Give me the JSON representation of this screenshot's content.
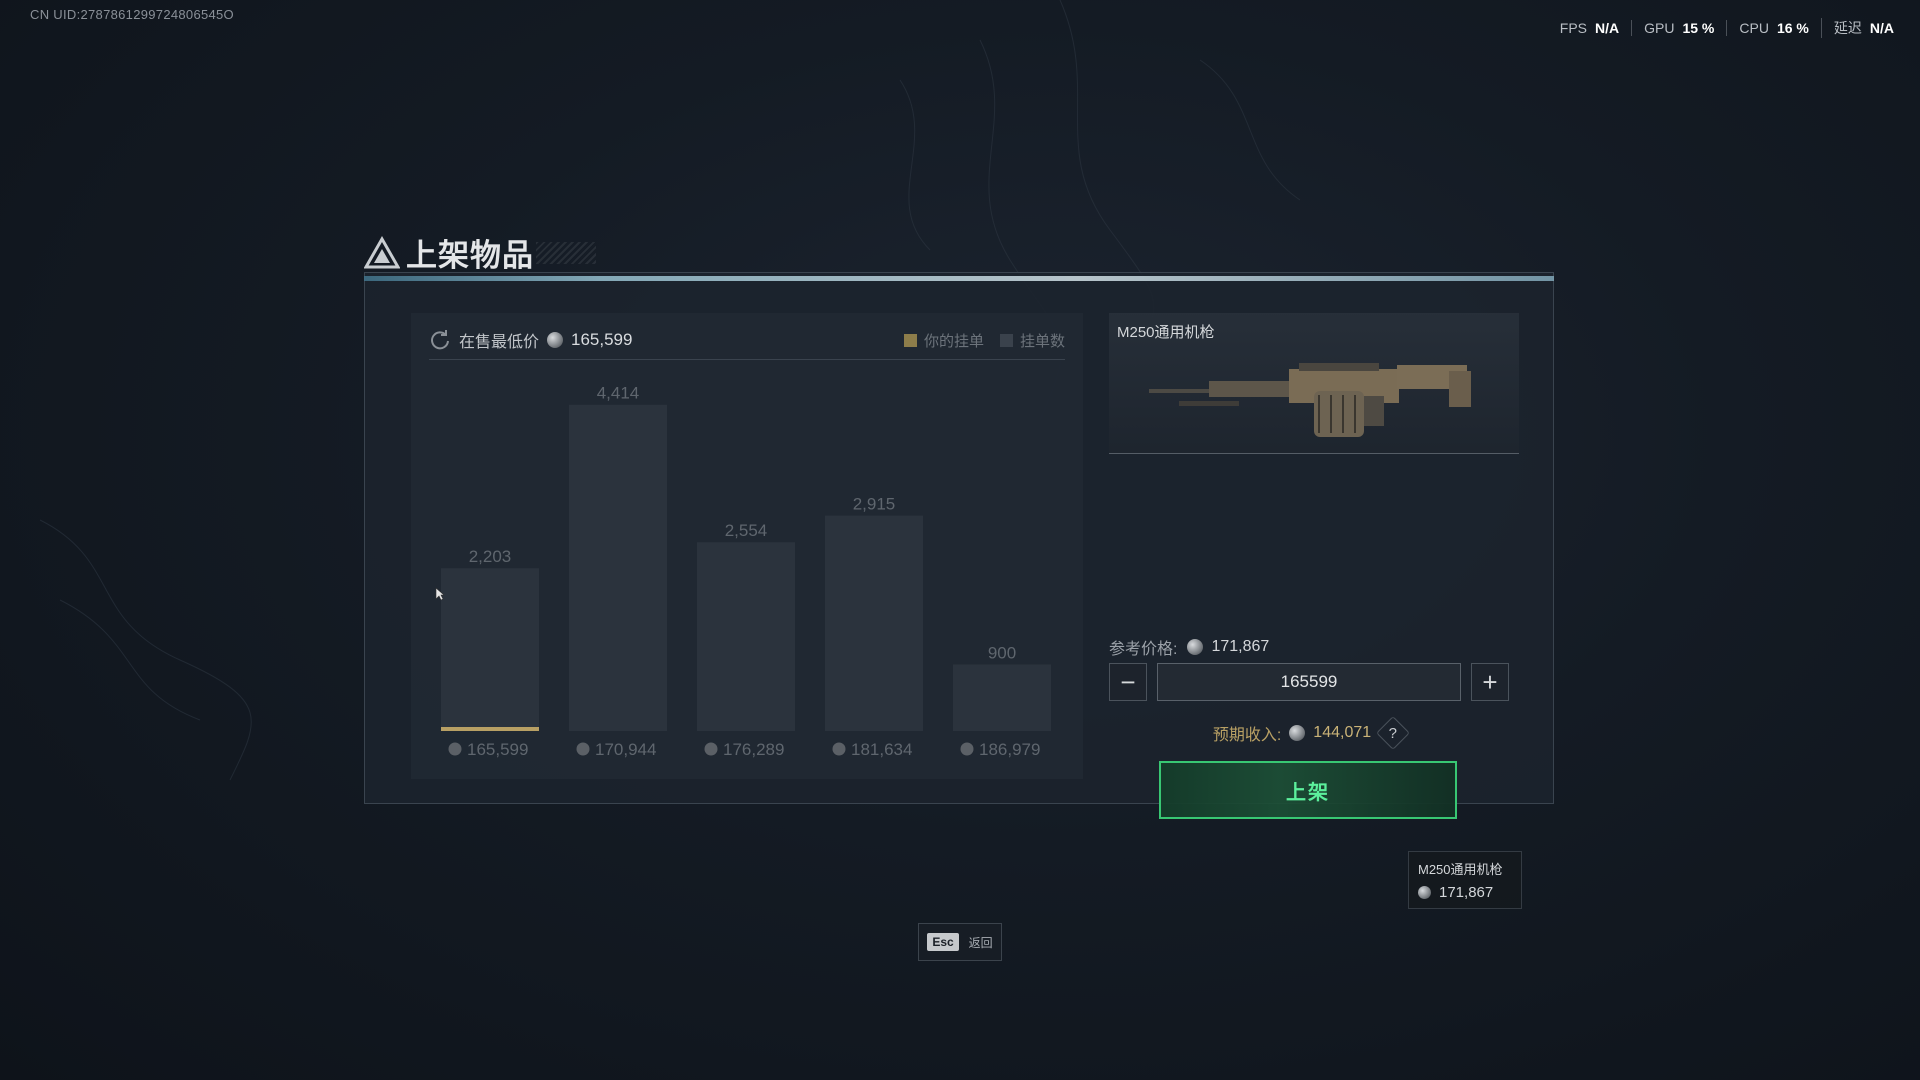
{
  "hud": {
    "uid": "CN UID:2787861299724806545O",
    "stats": [
      {
        "label": "FPS",
        "value": "N/A"
      },
      {
        "label": "GPU",
        "value": "15 %"
      },
      {
        "label": "CPU",
        "value": "16 %"
      },
      {
        "label": "延迟",
        "value": "N/A"
      }
    ]
  },
  "dialog": {
    "title": "上架物品",
    "chart_header": {
      "lowest_label": "在售最低价",
      "lowest_price": "165,599",
      "legend": [
        {
          "label": "你的挂单",
          "color": "#8d7d4a"
        },
        {
          "label": "挂单数",
          "color": "#3a424c"
        }
      ]
    },
    "item": {
      "name": "M250通用机枪",
      "icon": "machine-gun-image"
    },
    "reference_label": "参考价格:",
    "reference_price": "171,867",
    "price_input_value": "165599",
    "minus_label": "−",
    "plus_label": "+",
    "income_label": "预期收入:",
    "income_value": "144,071",
    "help_label": "?",
    "list_button_label": "上架"
  },
  "chart_data": {
    "type": "bar",
    "categories": [
      "165,599",
      "170,944",
      "176,289",
      "181,634",
      "186,979"
    ],
    "values": [
      2203,
      4414,
      2554,
      2915,
      900
    ],
    "value_labels": [
      "2,203",
      "4,414",
      "2,554",
      "2,915",
      "900"
    ],
    "ylim": [
      0,
      4600
    ],
    "highlight_index": 0,
    "highlight_color": "#b8a064"
  },
  "tooltip": {
    "name": "M250通用机枪",
    "price": "171,867"
  },
  "footer": {
    "esc_key": "Esc",
    "esc_label": "返回"
  }
}
